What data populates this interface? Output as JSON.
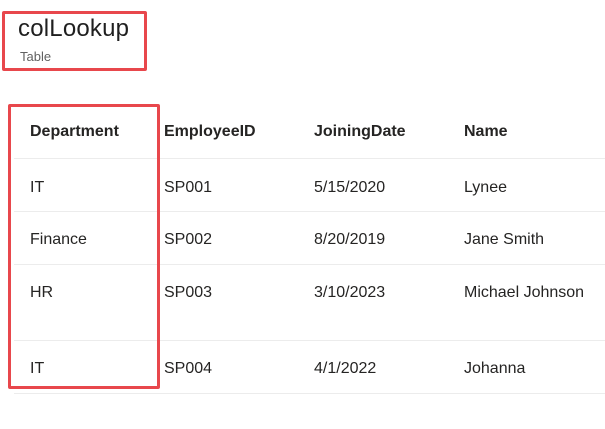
{
  "header": {
    "title": "colLookup",
    "subtitle": "Table"
  },
  "table": {
    "columns": [
      "Department",
      "EmployeeID",
      "JoiningDate",
      "Name"
    ],
    "rows": [
      [
        "IT",
        "SP001",
        "5/15/2020",
        "Lynee"
      ],
      [
        "Finance",
        "SP002",
        "8/20/2019",
        "Jane Smith"
      ],
      [
        "HR",
        "SP003",
        "3/10/2023",
        "Michael Johnson"
      ],
      [
        "IT",
        "SP004",
        "4/1/2022",
        "Johanna"
      ]
    ]
  },
  "colors": {
    "highlight": "#e8474c",
    "divider": "#ececec",
    "text": "#252423"
  }
}
